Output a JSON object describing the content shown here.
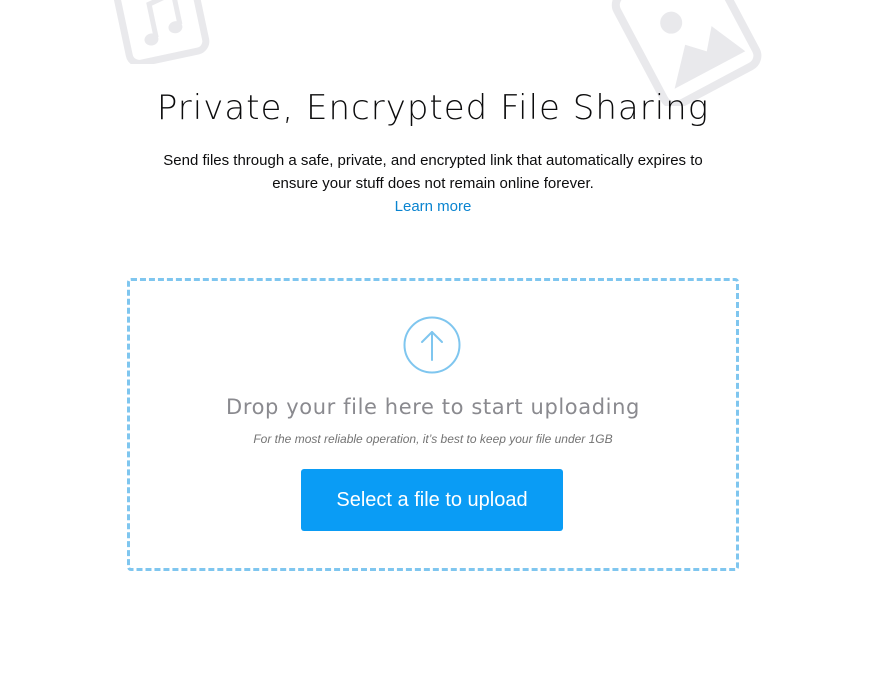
{
  "header": {
    "title": "Private, Encrypted File Sharing",
    "description": "Send files through a safe, private, and encrypted link that automatically expires to ensure your stuff does not remain online forever.",
    "learn_more_label": "Learn more"
  },
  "upload": {
    "drop_text": "Drop your file here to start uploading",
    "hint": "For the most reliable operation, it’s best to keep your file under 1GB",
    "button_label": "Select a file to upload"
  },
  "decorations": {
    "music_icon": "music-note-icon",
    "image_icon": "image-icon"
  },
  "colors": {
    "accent": "#0a9cf5",
    "link": "#0a84d0",
    "dropzone_border": "#7fc6ef",
    "decoration": "#e9e9ec"
  }
}
